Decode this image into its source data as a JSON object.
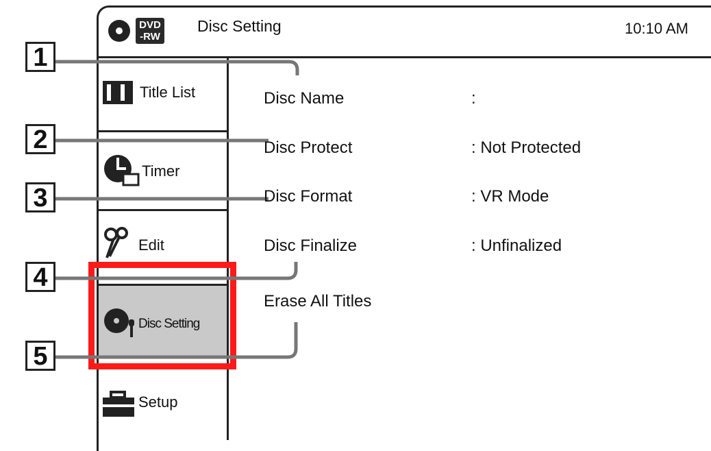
{
  "header": {
    "title": "Disc Setting",
    "time": "10:10 AM",
    "disc_badge": [
      "DVD",
      "-RW"
    ],
    "disc_icon": "disc-icon"
  },
  "sidebar": {
    "items": [
      {
        "label": "Title List",
        "icon": "film-strip-icon"
      },
      {
        "label": "Timer",
        "icon": "clock-icon"
      },
      {
        "label": "Edit",
        "icon": "scissors-icon"
      },
      {
        "label": "Disc Setting",
        "icon": "disc-setting-icon",
        "active": true
      },
      {
        "label": "Setup",
        "icon": "toolbox-icon"
      }
    ],
    "highlight_color": "#ff1a1a",
    "active_bg": "#c9c9c9"
  },
  "settings": [
    {
      "label": "Disc Name",
      "value": ":"
    },
    {
      "label": "Disc Protect",
      "value": ": Not Protected"
    },
    {
      "label": "Disc Format",
      "value": ": VR Mode"
    },
    {
      "label": "Disc Finalize",
      "value": ": Unfinalized"
    },
    {
      "label": "Erase All Titles",
      "value": ""
    }
  ],
  "callouts": [
    "1",
    "2",
    "3",
    "4",
    "5"
  ]
}
